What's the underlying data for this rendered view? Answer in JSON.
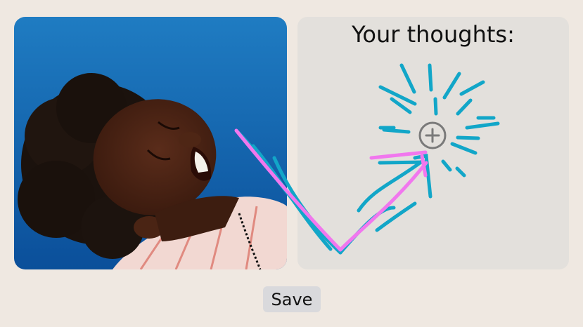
{
  "thoughts_panel": {
    "title": "Your thoughts:"
  },
  "photo": {
    "subject": "laughing-person-portrait"
  },
  "add_button": {
    "icon": "plus-circle-icon"
  },
  "save_button": {
    "label": "Save"
  },
  "colors": {
    "page_background": "#efe8e1",
    "panel_background": "#e3e0dc",
    "doodle_cyan": "#12a6c8",
    "doodle_pink": "#f177ee",
    "photo_background": "#1c73b8",
    "button_background": "#d9d9dc"
  }
}
